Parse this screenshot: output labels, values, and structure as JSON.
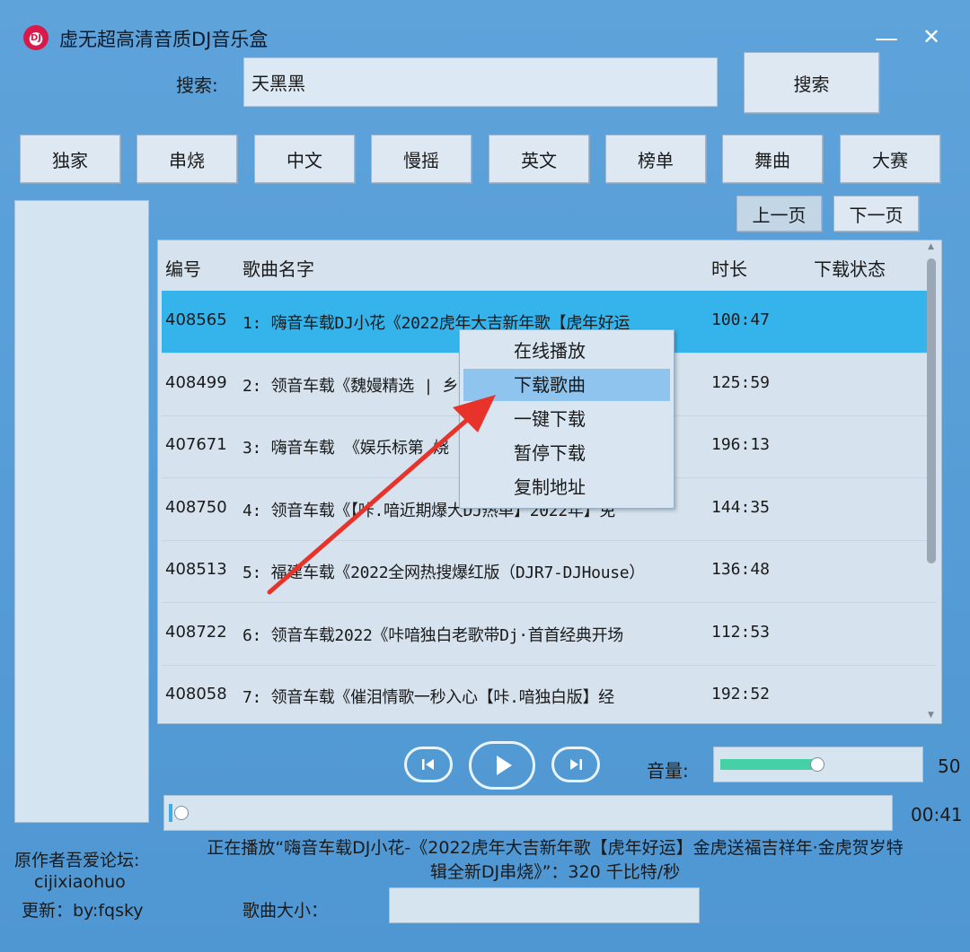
{
  "window": {
    "title": "虚无超高清音质DJ音乐盒",
    "logo_text": "DJ",
    "minimize": "—",
    "close": "✕"
  },
  "search": {
    "label": "搜索:",
    "value": "天黑黑",
    "button": "搜索"
  },
  "categories": [
    "独家",
    "串烧",
    "中文",
    "慢摇",
    "英文",
    "榜单",
    "舞曲",
    "大赛"
  ],
  "paging": {
    "prev": "上一页",
    "next": "下一页"
  },
  "table": {
    "headers": {
      "id": "编号",
      "name": "歌曲名字",
      "duration": "时长",
      "status": "下载状态"
    },
    "rows": [
      {
        "id": "408565",
        "name": "1: 嗨音车载DJ小花《2022虎年大吉新年歌【虎年好运",
        "duration": "100:47"
      },
      {
        "id": "408499",
        "name": "2: 领音车载《魏嫚精选 |                        乡",
        "duration": "125:59"
      },
      {
        "id": "407671",
        "name": "3: 嗨音车载  《娱乐标第                       烧",
        "duration": "196:13"
      },
      {
        "id": "408750",
        "name": "4: 领音车载《【咔.喑近期爆大DJ热单】2022年】免",
        "duration": "144:35"
      },
      {
        "id": "408513",
        "name": "5: 福建车载《2022全网热搜爆红版（DJR7-DJHouse）",
        "duration": "136:48"
      },
      {
        "id": "408722",
        "name": "6: 领音车载2022《咔喑独白老歌带Dj·首首经典开场",
        "duration": "112:53"
      },
      {
        "id": "408058",
        "name": "7: 领音车载《催泪情歌一秒入心【咔.喑独白版】经",
        "duration": "192:52"
      }
    ]
  },
  "context_menu": {
    "items": [
      "在线播放",
      "下载歌曲",
      "一键下载",
      "暂停下载",
      "复制地址"
    ],
    "highlighted_index": 1
  },
  "player": {
    "volume_label": "音量:",
    "volume_value": "50",
    "volume_level": 0.5,
    "time": "00:41",
    "now_playing_line1": "正在播放“嗨音车载DJ小花-《2022虎年大吉新年歌【虎年好运】金虎送福吉祥年·金虎贺岁特",
    "now_playing_line2": "辑全新DJ串烧》”：320 千比特/秒"
  },
  "footer": {
    "author_line1": "原作者吾爱论坛:",
    "author_line2": "cijixiaohuo",
    "author_line3": "更新：by:fqsky",
    "size_label": "歌曲大小："
  },
  "colors": {
    "background": "#5ea3da",
    "selected_row": "#35b4ec",
    "menu_highlight": "#8fc4ee",
    "arrow": "#e8332a",
    "volume_fill": "#45d0a5"
  }
}
